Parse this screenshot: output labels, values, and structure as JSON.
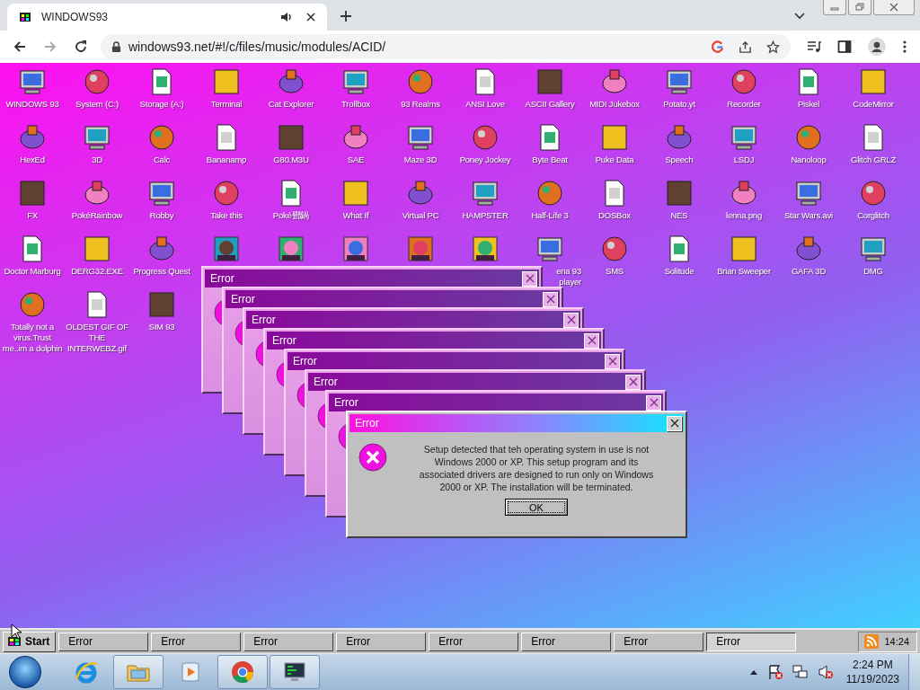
{
  "browser": {
    "tab": {
      "title": "WINDOWS93"
    },
    "url": "windows93.net/#!/c/files/music/modules/ACID/"
  },
  "desktop": {
    "icons": [
      {
        "label": "WINDOWS 93"
      },
      {
        "label": "System (C:)"
      },
      {
        "label": "Storage (A:)"
      },
      {
        "label": "Terminal"
      },
      {
        "label": "Cat Explorer"
      },
      {
        "label": "Trollbox"
      },
      {
        "label": "93 Realms"
      },
      {
        "label": "ANSI Love"
      },
      {
        "label": "ASCII Gallery"
      },
      {
        "label": "MIDI Jukebox"
      },
      {
        "label": "Potato.yt"
      },
      {
        "label": "Recorder"
      },
      {
        "label": "Piskel"
      },
      {
        "label": "CodeMirror"
      },
      {
        "label": "HexEd"
      },
      {
        "label": "3D"
      },
      {
        "label": "Calc"
      },
      {
        "label": "Bananamp"
      },
      {
        "label": "G80.M3U"
      },
      {
        "label": "SAE"
      },
      {
        "label": "Maze 3D"
      },
      {
        "label": "Poney Jockey"
      },
      {
        "label": "Byte Beat"
      },
      {
        "label": "Puke Data"
      },
      {
        "label": "Speech"
      },
      {
        "label": "LSDJ"
      },
      {
        "label": "Nanoloop"
      },
      {
        "label": "Glitch GRLZ"
      },
      {
        "label": "FX"
      },
      {
        "label": "PokéRainbow"
      },
      {
        "label": "Robby"
      },
      {
        "label": "Take this"
      },
      {
        "label": "Poké鄧鍋"
      },
      {
        "label": "What If"
      },
      {
        "label": "Virtual PC"
      },
      {
        "label": "HAMPSTER"
      },
      {
        "label": "Half-Life 3"
      },
      {
        "label": "DOSBox"
      },
      {
        "label": "NES"
      },
      {
        "label": "lenna.png"
      },
      {
        "label": "Star Wars.avi"
      },
      {
        "label": "Corglitch"
      },
      {
        "label": "Doctor Marburg"
      },
      {
        "label": "DERG32.EXE"
      },
      {
        "label": "Progress Quest"
      },
      {
        "kind": "image"
      },
      {
        "kind": "image"
      },
      {
        "kind": "image"
      },
      {
        "kind": "image"
      },
      {
        "kind": "image"
      },
      {
        "label": "ena 93 player"
      },
      {
        "label": "SMS"
      },
      {
        "label": "Solitude"
      },
      {
        "label": "Brian Sweeper"
      },
      {
        "label": "GAFA 3D"
      },
      {
        "label": "DMG"
      },
      {
        "label": "Totally not a virus.Trust me..im a dolphin"
      },
      {
        "label": "OLDEST GIF OF THE INTERWEBZ.gif"
      },
      {
        "label": "SIM 93"
      }
    ]
  },
  "dialogs": [
    {
      "title": "Error",
      "active": false
    },
    {
      "title": "Error",
      "active": false
    },
    {
      "title": "Error",
      "active": false
    },
    {
      "title": "Error",
      "active": false
    },
    {
      "title": "Error",
      "active": false
    },
    {
      "title": "Error",
      "active": false
    },
    {
      "title": "Error",
      "active": false
    },
    {
      "title": "Error",
      "active": true,
      "message": "Setup detected that teh operating system in use is not Windows 2000 or XP. This setup program and its associated drivers are designed to run only on Windows 2000 or XP. The installation will be terminated.",
      "button": "OK"
    }
  ],
  "w93_taskbar": {
    "start": "Start",
    "tasks": [
      {
        "label": "Error",
        "selected": false
      },
      {
        "label": "Error",
        "selected": false
      },
      {
        "label": "Error",
        "selected": false
      },
      {
        "label": "Error",
        "selected": false
      },
      {
        "label": "Error",
        "selected": false
      },
      {
        "label": "Error",
        "selected": false
      },
      {
        "label": "Error",
        "selected": false
      },
      {
        "label": "Error",
        "selected": true
      }
    ],
    "clock": "14:24"
  },
  "win_taskbar": {
    "apps": [
      {
        "kind": "ie",
        "running": false
      },
      {
        "kind": "folder",
        "running": true
      },
      {
        "kind": "media",
        "running": false
      },
      {
        "kind": "chrome",
        "running": true
      },
      {
        "kind": "monitor",
        "running": true
      }
    ],
    "time": "2:24 PM",
    "date": "11/19/2023"
  }
}
